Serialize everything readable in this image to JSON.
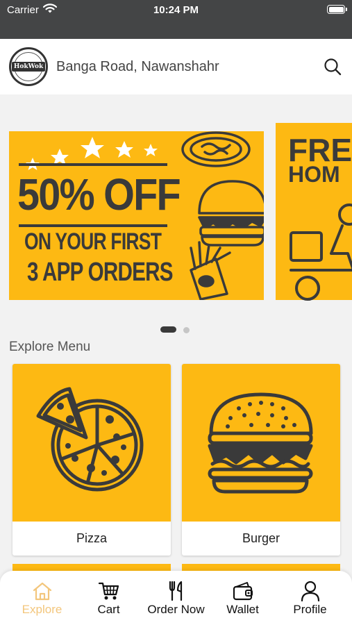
{
  "status_bar": {
    "carrier": "Carrier",
    "time": "10:24 PM"
  },
  "header": {
    "logo_text": "HokWok",
    "location": "Banga Road, Nawanshahr",
    "search_icon": "search-icon"
  },
  "banners": [
    {
      "line1": "50% OFF",
      "line2": "ON YOUR FIRST",
      "line3": "3 APP ORDERS"
    },
    {
      "line1": "FRE",
      "line2": "HOM"
    }
  ],
  "carousel": {
    "page_count": 2,
    "active_page": 1
  },
  "section": {
    "title": "Explore Menu"
  },
  "menu_items": [
    {
      "label": "Pizza",
      "icon": "pizza-icon"
    },
    {
      "label": "Burger",
      "icon": "burger-icon"
    }
  ],
  "tabs": [
    {
      "label": "Explore",
      "icon": "home-icon",
      "active": true
    },
    {
      "label": "Cart",
      "icon": "cart-icon",
      "active": false
    },
    {
      "label": "Order Now",
      "icon": "fork-knife-icon",
      "active": false
    },
    {
      "label": "Wallet",
      "icon": "wallet-icon",
      "active": false
    },
    {
      "label": "Profile",
      "icon": "person-icon",
      "active": false
    }
  ],
  "colors": {
    "accent": "#fdb913",
    "dark": "#3a3a3a",
    "active_tab": "#f3c67c",
    "status_bar": "#444546"
  }
}
